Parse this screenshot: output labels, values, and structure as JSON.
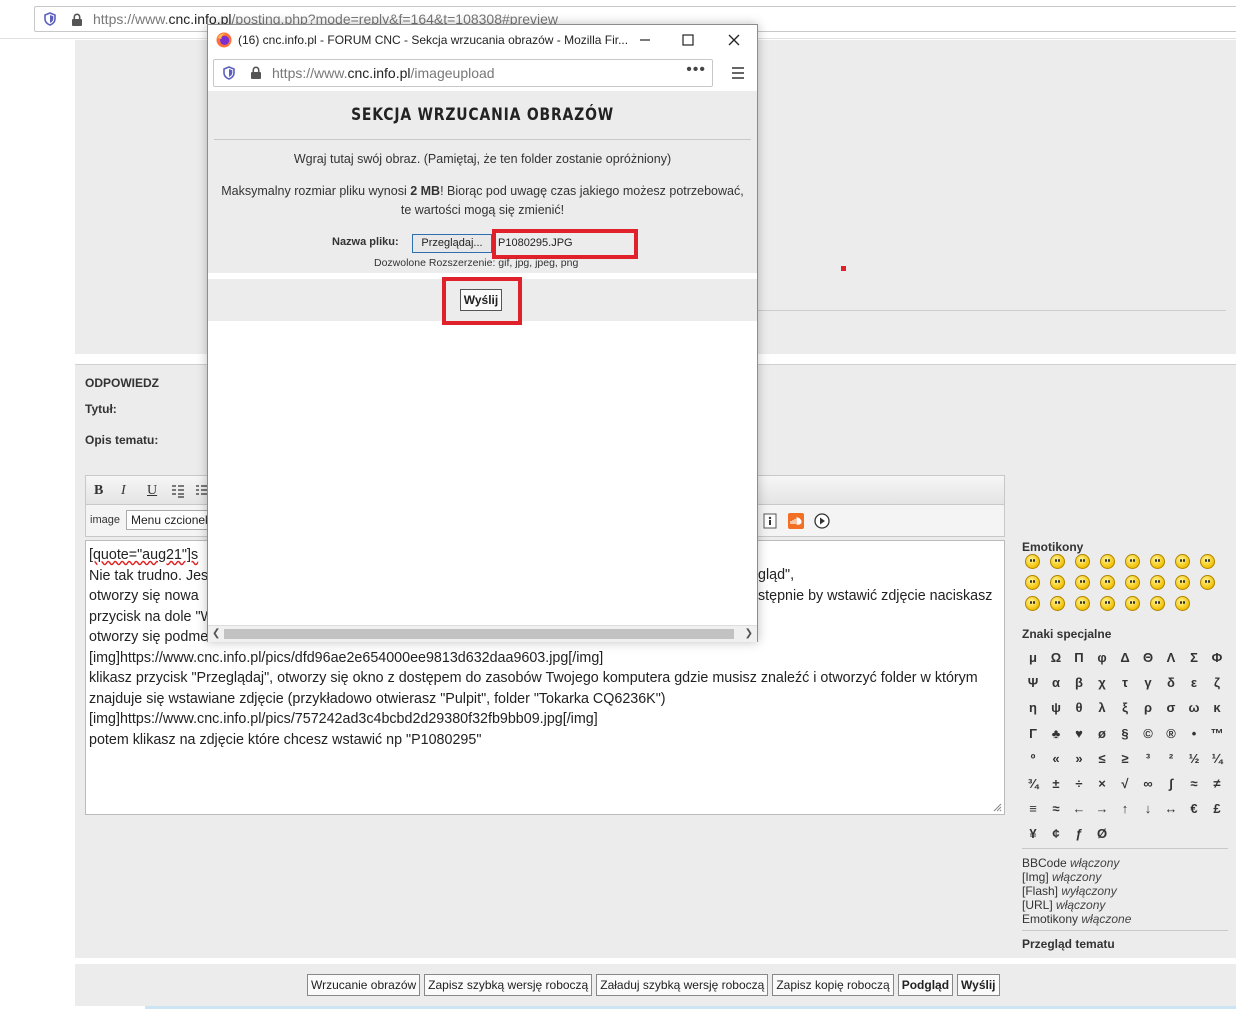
{
  "background_browser": {
    "url_prefix": "https://www.",
    "url_host": "cnc.info.pl",
    "url_path": "/posting.php?mode=reply&f=164&t=108308#preview"
  },
  "reply": {
    "section_title": "ODPOWIEDZ",
    "title_label": "Tytuł:",
    "desc_label": "Opis tematu:",
    "image_label": "image",
    "font_menu": "Menu czcionek",
    "toolbar_format": [
      "B",
      "I",
      "U"
    ],
    "editor_lines": [
      "[quote=\"aug21\"]s",
      "Nie tak trudno. Jes",
      "otworzy się nowa",
      "przycisk na dole \"W",
      "otworzy się podme",
      "[img]https://www.cnc.info.pl/pics/dfd96ae2e654000ee9813d632daa9603.jpg[/img]",
      "klikasz przycisk \"Przeglądaj\", otworzy się okno z dostępem do zasobów Twojego komputera gdzie musisz znaleźć i otworzyć folder w którym",
      "znajduje się wstawiane zdjęcie (przykładowo otwierasz \"Pulpit\", folder \"Tokarka CQ6236K\")",
      "[img]https://www.cnc.info.pl/pics/757242ad3c4bcbd2d29380f32fb9bb09.jpg[/img]",
      "potem klikasz na zdjęcie które chcesz wstawić np \"P1080295\""
    ],
    "editor_right_fragments": [
      "gląd\",",
      "stępnie by wstawić zdjęcie naciskasz"
    ]
  },
  "sidebar": {
    "emoticons_title": "Emotikony",
    "special_chars_title": "Znaki specjalne",
    "special_chars": [
      "μ",
      "Ω",
      "Π",
      "φ",
      "Δ",
      "Θ",
      "Λ",
      "Σ",
      "Φ",
      "Ψ",
      "α",
      "β",
      "χ",
      "τ",
      "γ",
      "δ",
      "ε",
      "ζ",
      "η",
      "ψ",
      "θ",
      "λ",
      "ξ",
      "ρ",
      "σ",
      "ω",
      "κ",
      "Γ",
      "♣",
      "♥",
      "ø",
      "§",
      "©",
      "®",
      "•",
      "™",
      "º",
      "«",
      "»",
      "≤",
      "≥",
      "³",
      "²",
      "½",
      "¼",
      "¾",
      "±",
      "÷",
      "×",
      "√",
      "∞",
      "∫",
      "≈",
      "≠",
      "≡",
      "≈",
      "←",
      "→",
      "↑",
      "↓",
      "↔",
      "€",
      "£",
      "¥",
      "¢",
      "ƒ",
      "Ø"
    ],
    "status": [
      {
        "label": "BBCode",
        "value": "włączony"
      },
      {
        "label": "[Img]",
        "value": "włączony"
      },
      {
        "label": "[Flash]",
        "value": "wyłączony"
      },
      {
        "label": "[URL]",
        "value": "włączony"
      },
      {
        "label": "Emotikony",
        "value": "włączone"
      }
    ],
    "topic_review": "Przegląd tematu"
  },
  "bottom_buttons": {
    "upload": "Wrzucanie obrazów",
    "save_quick": "Zapisz szybką wersję roboczą",
    "load_quick": "Załaduj szybką wersję roboczą",
    "save_copy": "Zapisz kopię roboczą",
    "preview": "Podgląd",
    "submit": "Wyślij"
  },
  "popup": {
    "window_title": "(16) cnc.info.pl - FORUM CNC - Sekcja wrzucania obrazów - Mozilla Fir...",
    "url_prefix": "https://www.",
    "url_host": "cnc.info.pl",
    "url_path": "/imageupload",
    "url_dots": "•••",
    "heading": "SEKCJA WRZUCANIA OBRAZÓW",
    "info_line": "Wgraj tutaj swój obraz. (Pamiętaj, że ten folder zostanie opróżniony)",
    "max_pre": "Maksymalny rozmiar pliku wynosi ",
    "max_size": "2 MB",
    "max_post": "! Biorąc pod uwagę czas jakiego możesz potrzebować,",
    "max_line2": "te wartości mogą się zmienić!",
    "file_label": "Nazwa pliku:",
    "browse_button": "Przeglądaj...",
    "file_name": "P1080295.JPG",
    "allowed_ext": "Dozwolone Rozszerzenie:  gif, jpg, jpeg, png",
    "submit_button": "Wyślij"
  },
  "colors": {
    "highlight_red": "#e0202a",
    "panel_gray": "#ececec",
    "browse_border": "#2f6fb0"
  }
}
